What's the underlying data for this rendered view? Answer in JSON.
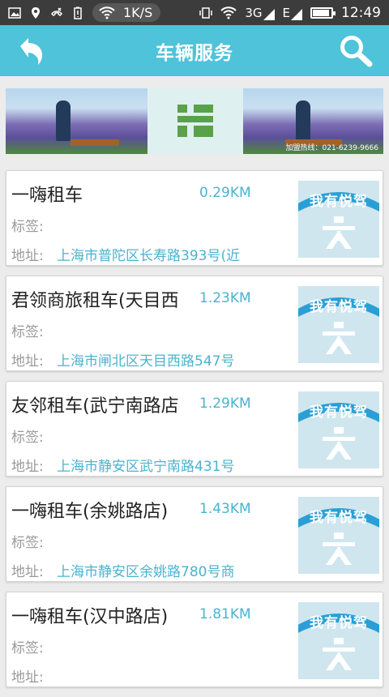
{
  "status_bar": {
    "net_speed": "1K/S",
    "network_type": "3G",
    "network_type_2": "E",
    "time": "12:49",
    "battery_level": 0.85,
    "icons": [
      "image-icon",
      "location-icon",
      "phone-missed-icon",
      "battery-saver-icon",
      "wifi-icon",
      "vibrate-icon",
      "wifi-icon",
      "signal-icon",
      "signal-icon",
      "battery-icon"
    ]
  },
  "header": {
    "title": "车辆服务",
    "back_icon": "back-arrow-icon",
    "search_icon": "search-icon",
    "background": "#4ec3d9"
  },
  "banner": {
    "phone_text": "加盟热线：021-6239-9666"
  },
  "rentals": [
    {
      "name": "一嗨租车",
      "distance": "0.29KM",
      "tag_label": "标签:",
      "address_label": "地址:",
      "address": "上海市普陀区长寿路393号(近",
      "logo_text": "我有悦驾"
    },
    {
      "name": "君领商旅租车(天目西",
      "distance": "1.23KM",
      "tag_label": "标签:",
      "address_label": "地址:",
      "address": "上海市闸北区天目西路547号",
      "logo_text": "我有悦驾"
    },
    {
      "name": "友邻租车(武宁南路店",
      "distance": "1.29KM",
      "tag_label": "标签:",
      "address_label": "地址:",
      "address": "上海市静安区武宁南路431号",
      "logo_text": "我有悦驾"
    },
    {
      "name": "一嗨租车(余姚路店)",
      "distance": "1.43KM",
      "tag_label": "标签:",
      "address_label": "地址:",
      "address": "上海市静安区余姚路780号商",
      "logo_text": "我有悦驾"
    },
    {
      "name": "一嗨租车(汉中路店)",
      "distance": "1.81KM",
      "tag_label": "标签:",
      "address_label": "地址:",
      "address": "",
      "logo_text": "我有悦驾"
    }
  ],
  "colors": {
    "accent": "#4ec3d9",
    "link": "#4ab3cf",
    "label": "#9a9a9a",
    "logo_ribbon": "#2a9fd6"
  }
}
